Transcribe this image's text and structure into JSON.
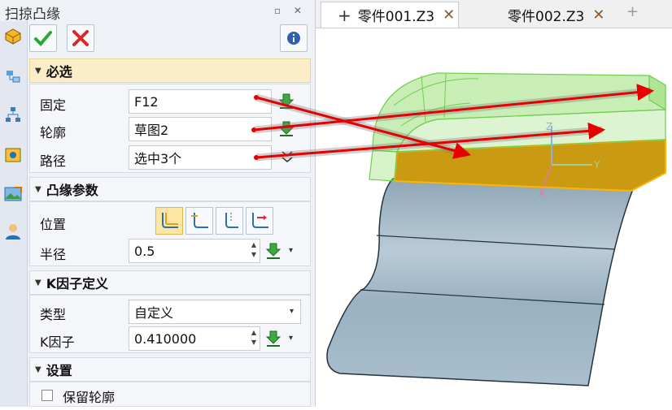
{
  "panel": {
    "title": "扫掠凸缘",
    "window_controls": "▫ ✕"
  },
  "sections": {
    "required": {
      "header": "必选",
      "fixed_label": "固定",
      "fixed_value": "F12",
      "profile_label": "轮廓",
      "profile_value": "草图2",
      "path_label": "路径",
      "path_value": "选中3个"
    },
    "flange": {
      "header": "凸缘参数",
      "position_label": "位置",
      "radius_label": "半径",
      "radius_value": "0.5"
    },
    "kfactor": {
      "header": "K因子定义",
      "type_label": "类型",
      "type_value": "自定义",
      "k_label": "K因子",
      "k_value": "0.410000"
    },
    "settings": {
      "header": "设置",
      "keep_profile_label": "保留轮廓",
      "keep_profile_checked": false
    }
  },
  "tabs": [
    {
      "label": "零件001.Z3",
      "prefix": "+",
      "active": true
    },
    {
      "label": "零件002.Z3",
      "active": false
    }
  ],
  "add_tab": "+",
  "colors": {
    "accent_yellow": "#fde6a3",
    "panel_bg": "#eef1f6",
    "section_header_bg": "#fbedc7",
    "green_check": "#2ea635",
    "red_cancel": "#d62a2a",
    "part_face": "#9bb3c2",
    "selected_face": "#c99a12",
    "ghost_green": "#9be07a",
    "arrow_red": "#e60000"
  }
}
